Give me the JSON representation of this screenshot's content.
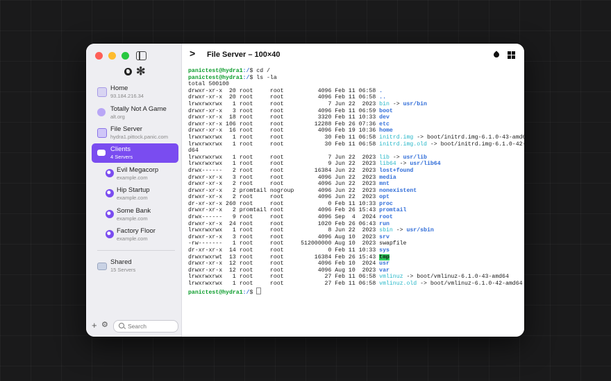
{
  "sidebar": {
    "items": [
      {
        "title": "Home",
        "subtitle": "93.184.216.34"
      },
      {
        "title": "Totally Not A Game",
        "subtitle": "alt.org"
      },
      {
        "title": "File Server",
        "subtitle": "hydra1.pittock.panic.com"
      },
      {
        "title": "Clients",
        "subtitle": "4 Servers"
      },
      {
        "title": "Evil Megacorp",
        "subtitle": "example.com"
      },
      {
        "title": "Hip Startup",
        "subtitle": "example.com"
      },
      {
        "title": "Some Bank",
        "subtitle": "example.com"
      },
      {
        "title": "Factory Floor",
        "subtitle": "example.com"
      },
      {
        "title": "Shared",
        "subtitle": "15 Servers"
      }
    ],
    "search_placeholder": "Search",
    "add_glyph": "+",
    "gear_glyph": "⚙"
  },
  "window": {
    "title": "File Server – 100×40",
    "prompt_glyph": ">"
  },
  "terminal": {
    "prompt_user": "panictest@hydra1",
    "prompt_path": ":/",
    "commands": [
      "$ cd /",
      "$ ls -la",
      "$ "
    ],
    "total": "total 500100",
    "rows": [
      {
        "meta": "drwxr-xr-x  20 root     root          4096 Feb 11 06:58 ",
        "name": ".",
        "type": "dir",
        "target": ""
      },
      {
        "meta": "drwxr-xr-x  20 root     root          4096 Feb 11 06:58 ",
        "name": "..",
        "type": "dir",
        "target": ""
      },
      {
        "meta": "lrwxrwxrwx   1 root     root             7 Jun 22  2023 ",
        "name": "bin",
        "type": "link",
        "target": "usr/bin"
      },
      {
        "meta": "drwxr-xr-x   3 root     root          4096 Feb 11 06:59 ",
        "name": "boot",
        "type": "dir",
        "target": ""
      },
      {
        "meta": "drwxr-xr-x  18 root     root          3320 Feb 11 10:33 ",
        "name": "dev",
        "type": "dir",
        "target": ""
      },
      {
        "meta": "drwxr-xr-x 106 root     root         12288 Feb 26 07:36 ",
        "name": "etc",
        "type": "dir",
        "target": ""
      },
      {
        "meta": "drwxr-xr-x  16 root     root          4096 Feb 19 10:36 ",
        "name": "home",
        "type": "dir",
        "target": ""
      },
      {
        "meta": "lrwxrwxrwx   1 root     root            30 Feb 11 06:58 ",
        "name": "initrd.img",
        "type": "link",
        "target": "boot/initrd.img-6.1.0-43-amd64"
      },
      {
        "meta": "lrwxrwxrwx   1 root     root            30 Feb 11 06:58 ",
        "name": "initrd.img.old",
        "type": "link",
        "target": "boot/initrd.img-6.1.0-42-am"
      },
      {
        "meta": "d64",
        "name": "",
        "type": "wrap",
        "target": ""
      },
      {
        "meta": "lrwxrwxrwx   1 root     root             7 Jun 22  2023 ",
        "name": "lib",
        "type": "link",
        "target": "usr/lib"
      },
      {
        "meta": "lrwxrwxrwx   1 root     root             9 Jun 22  2023 ",
        "name": "lib64",
        "type": "link",
        "target": "usr/lib64"
      },
      {
        "meta": "drwx------   2 root     root         16384 Jun 22  2023 ",
        "name": "lost+found",
        "type": "dir",
        "target": ""
      },
      {
        "meta": "drwxr-xr-x   3 root     root          4096 Jun 22  2023 ",
        "name": "media",
        "type": "dir",
        "target": ""
      },
      {
        "meta": "drwxr-xr-x   2 root     root          4096 Jun 22  2023 ",
        "name": "mnt",
        "type": "dir",
        "target": ""
      },
      {
        "meta": "drwxr-xr-x   2 promtail nogroup       4096 Jun 22  2023 ",
        "name": "nonexistent",
        "type": "dir",
        "target": ""
      },
      {
        "meta": "drwxr-xr-x   2 root     root          4096 Jun 22  2023 ",
        "name": "opt",
        "type": "dir",
        "target": ""
      },
      {
        "meta": "dr-xr-xr-x 260 root     root             0 Feb 11 10:33 ",
        "name": "proc",
        "type": "dir",
        "target": ""
      },
      {
        "meta": "drwxr-xr-x   2 promtail root          4096 Feb 26 15:43 ",
        "name": "promtail",
        "type": "dir",
        "target": ""
      },
      {
        "meta": "drwx------   9 root     root          4096 Sep  4  2024 ",
        "name": "root",
        "type": "dir",
        "target": ""
      },
      {
        "meta": "drwxr-xr-x  24 root     root          1020 Feb 26 06:43 ",
        "name": "run",
        "type": "dir",
        "target": ""
      },
      {
        "meta": "lrwxrwxrwx   1 root     root             8 Jun 22  2023 ",
        "name": "sbin",
        "type": "link",
        "target": "usr/sbin"
      },
      {
        "meta": "drwxr-xr-x   3 root     root          4096 Aug 10  2023 ",
        "name": "srv",
        "type": "dir",
        "target": ""
      },
      {
        "meta": "-rw-------   1 root     root     512000000 Aug 10  2023 ",
        "name": "swapfile",
        "type": "file",
        "target": ""
      },
      {
        "meta": "dr-xr-xr-x  14 root     root             0 Feb 11 10:33 ",
        "name": "sys",
        "type": "dir",
        "target": ""
      },
      {
        "meta": "drwxrwxrwt  13 root     root         16384 Feb 26 15:43 ",
        "name": "tmp",
        "type": "sticky",
        "target": ""
      },
      {
        "meta": "drwxr-xr-x  12 root     root          4096 Feb 10  2024 ",
        "name": "usr",
        "type": "dir",
        "target": ""
      },
      {
        "meta": "drwxr-xr-x  12 root     root          4096 Aug 10  2023 ",
        "name": "var",
        "type": "dir",
        "target": ""
      },
      {
        "meta": "lrwxrwxrwx   1 root     root            27 Feb 11 06:58 ",
        "name": "vmlinuz",
        "type": "link",
        "target": "boot/vmlinuz-6.1.0-43-amd64"
      },
      {
        "meta": "lrwxrwxrwx   1 root     root            27 Feb 11 06:58 ",
        "name": "vmlinuz.old",
        "type": "link",
        "target": "boot/vmlinuz-6.1.0-42-amd64"
      }
    ],
    "arrow": " -> "
  },
  "colors": {
    "accent": "#7a4cf0",
    "prompt_user": "#0b9c2b",
    "directory": "#2f6cd8",
    "symlink": "#27b7c8",
    "sticky_bg": "#2fd060"
  },
  "icons": {
    "sidebar_top": [
      "globe-icon",
      "asterisk-icon"
    ],
    "titlebar_right": [
      "drop-icon",
      "grid-icon"
    ]
  }
}
